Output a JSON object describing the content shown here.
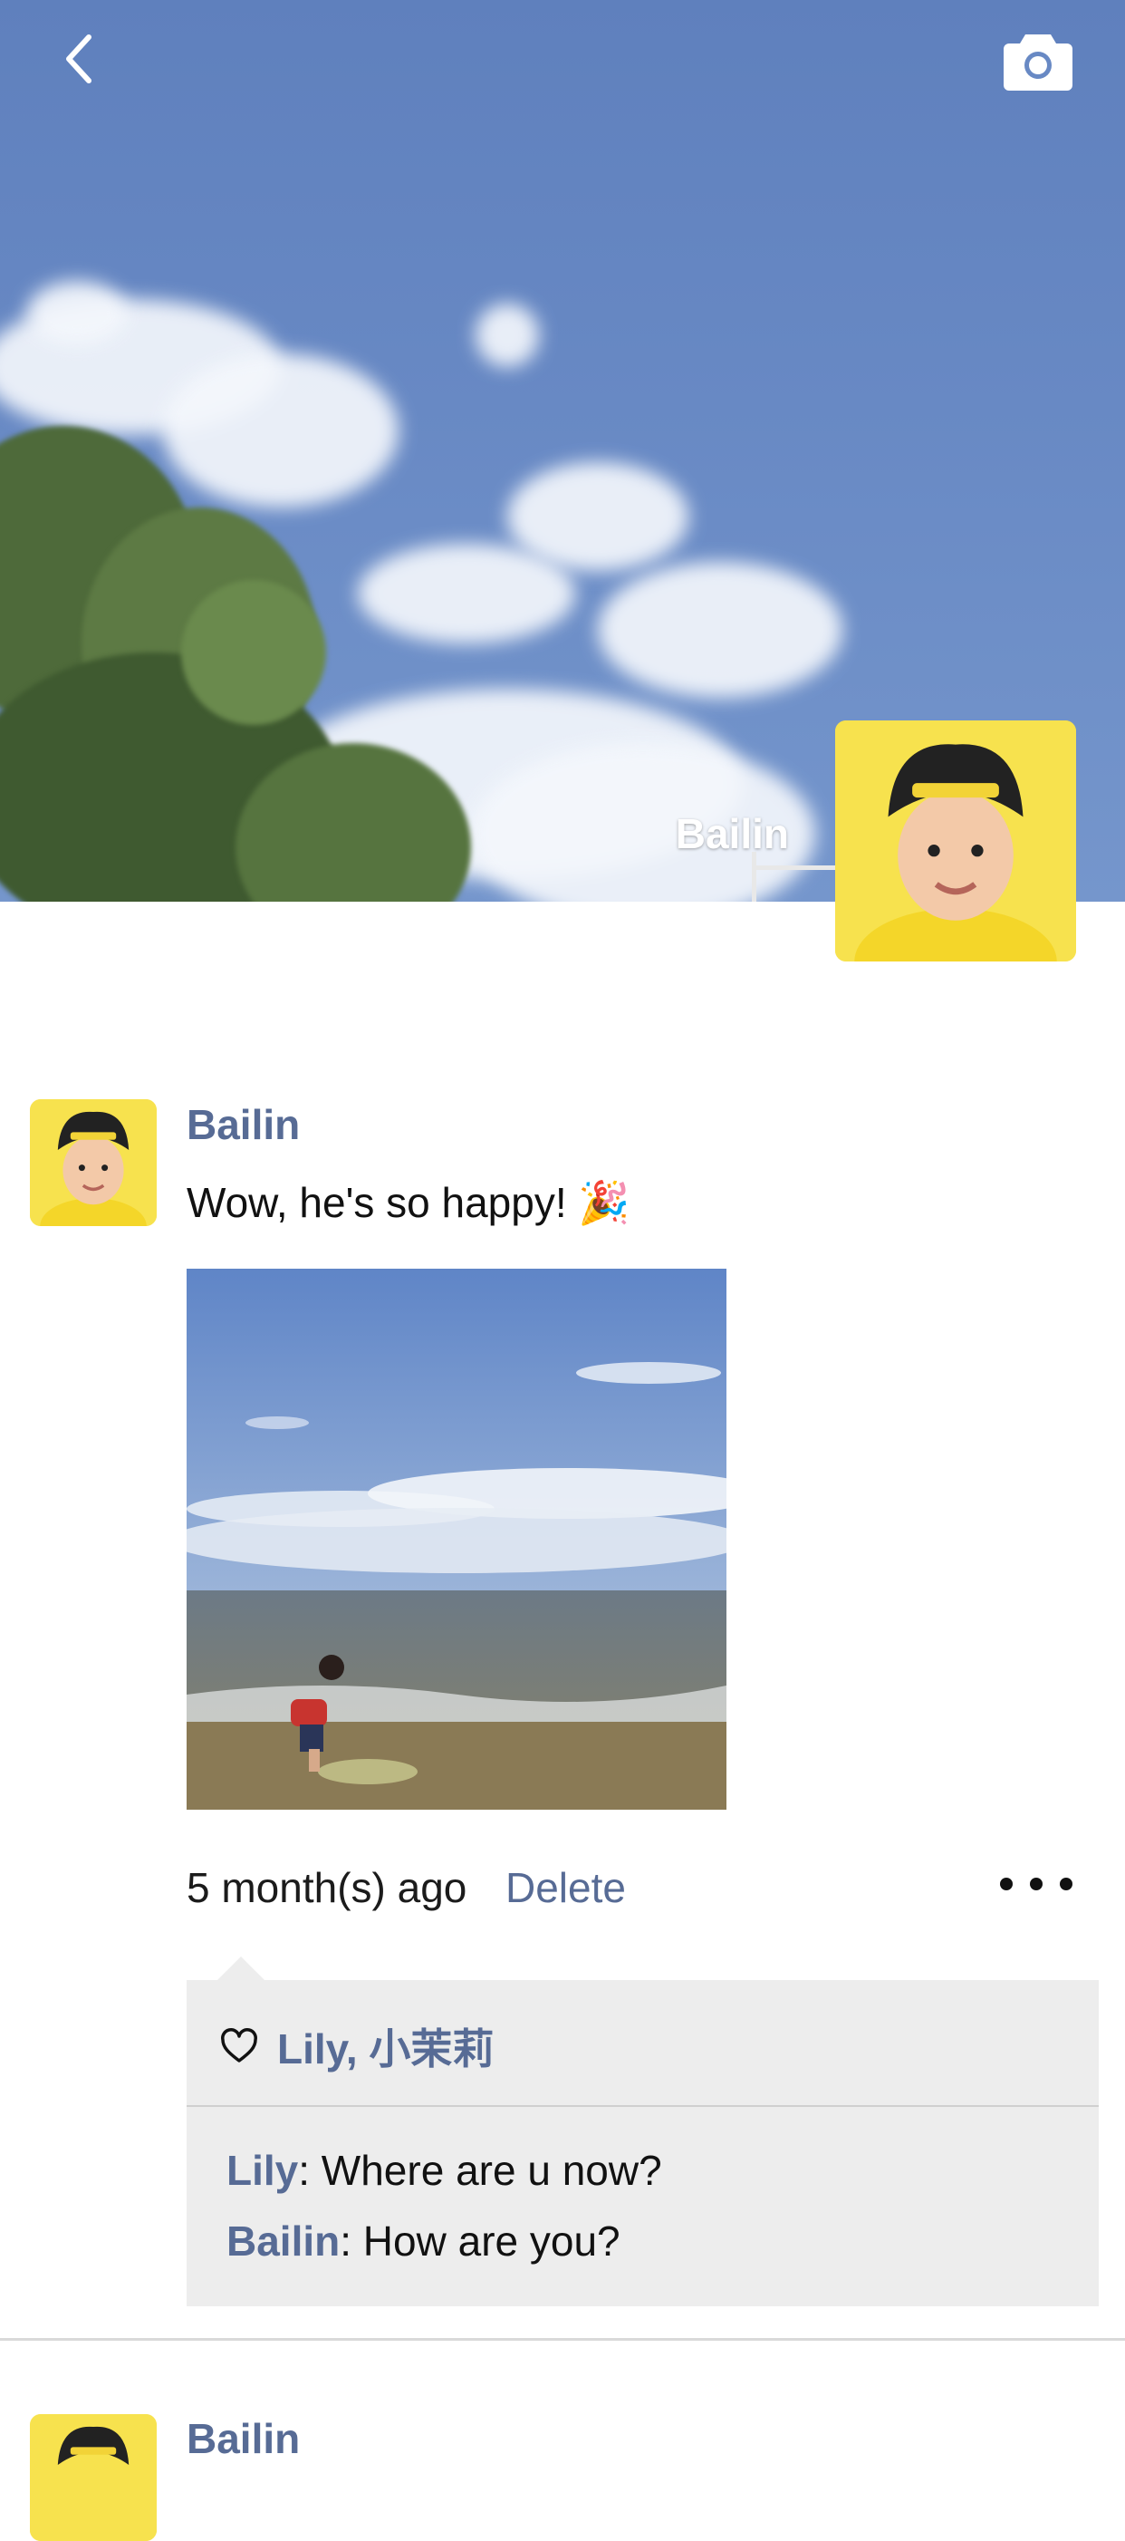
{
  "cover": {
    "user_name": "Bailin",
    "back_icon": "chevron-left-icon",
    "camera_icon": "camera-icon"
  },
  "post": {
    "author": "Bailin",
    "text": "Wow, he's so happy! 🎉",
    "time": "5 month(s) ago",
    "delete_label": "Delete",
    "more_icon": "more-horizontal-icon",
    "likes": {
      "icon": "heart-outline-icon",
      "names": "Lily, 小茉莉"
    },
    "comments": [
      {
        "author": "Lily",
        "text": ": Where are u now?"
      },
      {
        "author": "Bailin",
        "text": ": How are you?"
      }
    ]
  },
  "next_post": {
    "author": "Bailin"
  },
  "colors": {
    "link": "#576b95",
    "comment_bg": "#ededed",
    "sky": "#6889c4",
    "avatar_bg": "#f7e24e"
  }
}
